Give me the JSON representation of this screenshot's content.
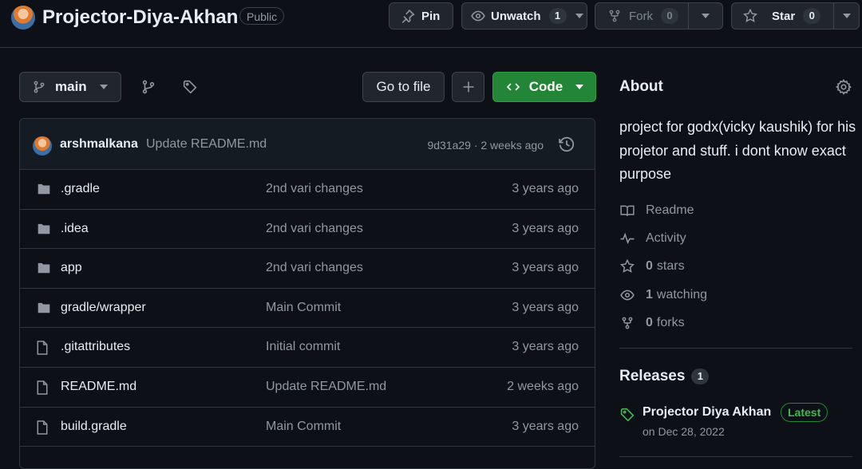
{
  "repo": {
    "name": "Projector-Diya-Akhan",
    "visibility": "Public"
  },
  "header": {
    "pin_label": "Pin",
    "unwatch_label": "Unwatch",
    "watch_count": "1",
    "fork_label": "Fork",
    "fork_count": "0",
    "star_label": "Star",
    "star_count": "0"
  },
  "toolbar": {
    "branch": "main",
    "goto_file": "Go to file",
    "code_label": "Code"
  },
  "commit": {
    "author": "arshmalkana",
    "message": "Update README.md",
    "meta": "9d31a29 · 2 weeks ago"
  },
  "files": [
    {
      "type": "folder",
      "name": ".gradle",
      "commit": "2nd vari changes",
      "age": "3 years ago"
    },
    {
      "type": "folder",
      "name": ".idea",
      "commit": "2nd vari changes",
      "age": "3 years ago"
    },
    {
      "type": "folder",
      "name": "app",
      "commit": "2nd vari changes",
      "age": "3 years ago"
    },
    {
      "type": "folder",
      "name": "gradle/wrapper",
      "commit": "Main Commit",
      "age": "3 years ago"
    },
    {
      "type": "file",
      "name": ".gitattributes",
      "commit": "Initial commit",
      "age": "3 years ago"
    },
    {
      "type": "file",
      "name": "README.md",
      "commit": "Update README.md",
      "age": "2 weeks ago"
    },
    {
      "type": "file",
      "name": "build.gradle",
      "commit": "Main Commit",
      "age": "3 years ago"
    }
  ],
  "about": {
    "title": "About",
    "description": "project for godx(vicky kaushik) for his projetor and stuff. i dont know exact purpose",
    "readme": "Readme",
    "activity": "Activity",
    "stars_count": "0",
    "stars_label": "stars",
    "watching_count": "1",
    "watching_label": "watching",
    "forks_count": "0",
    "forks_label": "forks"
  },
  "releases": {
    "title": "Releases",
    "count": "1",
    "latest_name": "Projector Diya Akhan",
    "latest_badge": "Latest",
    "latest_date": "on Dec 28, 2022"
  },
  "colors": {
    "background": "#0d1117",
    "accent_green": "#238636",
    "latest_green": "#3fb950",
    "muted": "#9198a1"
  }
}
